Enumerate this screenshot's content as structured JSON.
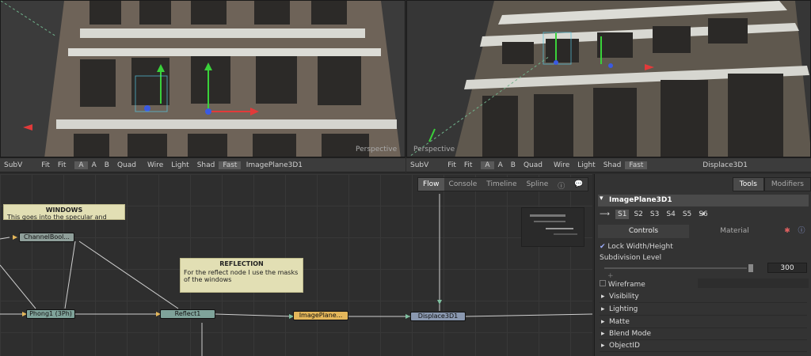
{
  "left_viewport": {
    "label": "Perspective",
    "toolbar": {
      "subv": "SubV",
      "fit1": "Fit",
      "fit2": "Fit",
      "a1": "A",
      "a2": "A",
      "b": "B",
      "quad": "Quad",
      "wire": "Wire",
      "light": "Light",
      "shad": "Shad",
      "fast": "Fast",
      "title": "ImagePlane3D1"
    }
  },
  "right_viewport": {
    "label": "Perspective",
    "toolbar": {
      "subv": "SubV",
      "fit1": "Fit",
      "fit2": "Fit",
      "a1": "A",
      "a2": "A",
      "b": "B",
      "quad": "Quad",
      "wire": "Wire",
      "light": "Light",
      "shad": "Shad",
      "fast": "Fast",
      "title": "Displace3D1"
    }
  },
  "flow_tabs": {
    "flow": "Flow",
    "console": "Console",
    "timeline": "Timeline",
    "spline": "Spline"
  },
  "notes": {
    "windows": {
      "title": "WINDOWS",
      "body": "This goes into the specular and"
    },
    "reflection": {
      "title": "REFLECTION",
      "body": "For the reflect node I use the masks of the windows"
    }
  },
  "nodes": {
    "channelbool": "ChannelBool...",
    "phong": "Phong1 (3Ph)",
    "reflect": "Reflect1",
    "imageplane": "ImagePlane...",
    "displace": "Displace3D1"
  },
  "inspector": {
    "tabs": {
      "tools": "Tools",
      "modifiers": "Modifiers"
    },
    "header": "ImagePlane3D1",
    "scene_tabs": [
      "S1",
      "S2",
      "S3",
      "S4",
      "S5",
      "S6"
    ],
    "subtabs": {
      "controls": "Controls",
      "material": "Material"
    },
    "lock_label": "Lock Width/Height",
    "subdivision_label": "Subdivision Level",
    "subdivision_value": "300",
    "wireframe_label": "Wireframe",
    "sections": [
      "Visibility",
      "Lighting",
      "Matte",
      "Blend Mode",
      "ObjectID"
    ]
  },
  "colors": {
    "node_green": "#7fa39a",
    "node_blue": "#8a98b0",
    "node_yellow": "#e3b65a",
    "note_bg": "#e2dfb4"
  }
}
